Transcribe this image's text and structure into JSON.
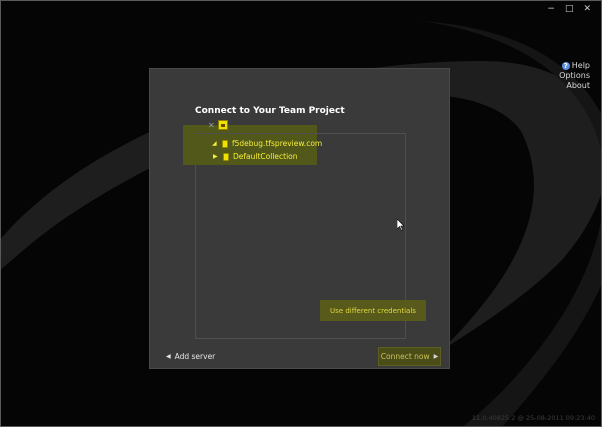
{
  "window": {
    "controls": [
      {
        "name": "minimize",
        "glyph": "−"
      },
      {
        "name": "restore",
        "glyph": "□"
      },
      {
        "name": "close",
        "glyph": "✕"
      }
    ]
  },
  "toplinks": {
    "help": "Help",
    "options": "Options",
    "about": "About",
    "help_icon_glyph": "?"
  },
  "panel": {
    "title": "Connect to Your Team Project",
    "toolbar": {
      "close_glyph": "✕",
      "icon": "server-add-icon"
    },
    "tree": {
      "server": {
        "label": "f5debug.tfspreview.com",
        "expander": "◢"
      },
      "collection": {
        "label": "DefaultCollection",
        "expander": "▶"
      }
    },
    "use_credentials": "Use different credentials",
    "add_server": "Add server",
    "add_server_glyph": "◀",
    "connect_now": "Connect now",
    "connect_now_glyph": "▶"
  },
  "footer": {
    "stamp": "11.0.40825.2 @ 25-08-2011 09:23:40"
  },
  "colors": {
    "background": "#020202",
    "panel": "#3a3a3a",
    "highlight": "#535a17",
    "accent_text": "#f5ee3a"
  }
}
